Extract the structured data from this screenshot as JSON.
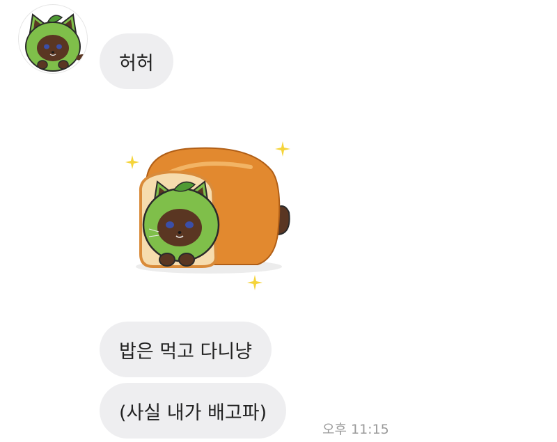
{
  "messages": [
    {
      "text": "허허"
    },
    {
      "text": "밥은 먹고 다니냥"
    },
    {
      "text": "(사실 내가 배고파)"
    }
  ],
  "last_message_time": "오후 11:15",
  "avatar": {
    "icon": "green-hooded-cat-avatar-icon"
  },
  "sticker": {
    "icon": "cat-in-bread-loaf-sticker"
  },
  "colors": {
    "bubble_bg": "#eeeef0",
    "text": "#222222",
    "timestamp": "#9a9a9a",
    "hood_green": "#7fbf4a",
    "bread": "#e2892f"
  }
}
